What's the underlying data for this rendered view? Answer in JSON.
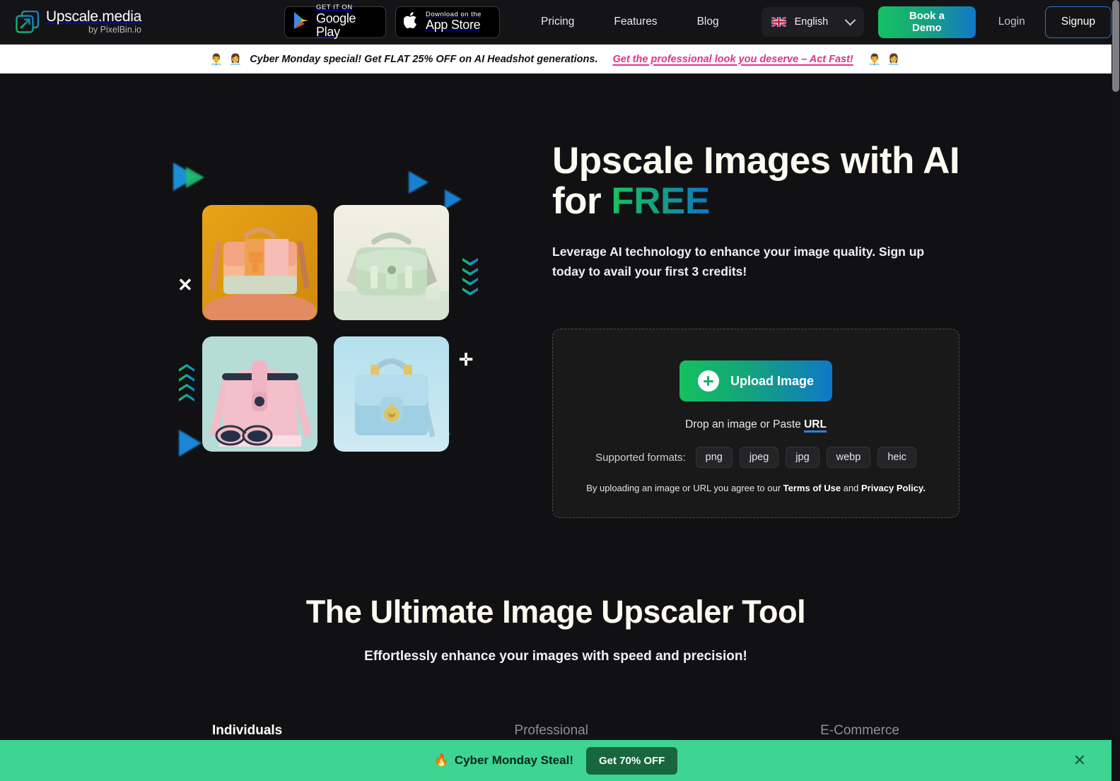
{
  "header": {
    "logo": {
      "title": "Upscale.media",
      "subtitle": "by PixelBin.io",
      "icon": "upscale-logo-icon"
    },
    "google_play": {
      "small": "GET IT ON",
      "big": "Google Play",
      "icon": "google-play-icon"
    },
    "app_store": {
      "small": "Download on the",
      "big": "App Store",
      "icon": "apple-icon"
    },
    "nav": [
      {
        "label": "Pricing"
      },
      {
        "label": "Features"
      },
      {
        "label": "Blog"
      }
    ],
    "language": {
      "label": "English",
      "flag": "uk-flag-icon",
      "chevron": "chevron-down-icon"
    },
    "book_demo": "Book a Demo",
    "login": "Login",
    "signup": "Signup"
  },
  "promo": {
    "emoji_left": "👨‍💼 👩‍💼",
    "text": "Cyber Monday special! Get FLAT 25% OFF on AI Headshot generations.",
    "cta": "Get the professional look you deserve – Act Fast!",
    "emoji_right": "👨‍💼 👩‍💼"
  },
  "hero": {
    "title_line1": "Upscale Images with AI",
    "title_line2_prefix": "for ",
    "title_highlight": "FREE",
    "subtitle": "Leverage AI technology to enhance your image quality. Sign up today to avail your first 3 credits!",
    "collage_alt": [
      "handbag-orange-tile",
      "handbag-mint-tile",
      "handbag-pink-tile",
      "handbag-blue-tile"
    ]
  },
  "upload": {
    "button_label": "Upload Image",
    "drop_text": "Drop an image or Paste ",
    "drop_link": "URL",
    "formats_label": "Supported formats:",
    "formats": [
      "png",
      "jpeg",
      "jpg",
      "webp",
      "heic"
    ],
    "legal_prefix": "By uploading an image or URL you agree to our ",
    "legal_terms": "Terms of Use",
    "legal_mid": " and ",
    "legal_privacy": "Privacy Policy."
  },
  "section2": {
    "heading": "The Ultimate Image Upscaler Tool",
    "subheading": "Effortlessly enhance your images with speed and precision!",
    "tabs": [
      {
        "label": "Individuals",
        "active": true
      },
      {
        "label": "Professional",
        "active": false
      },
      {
        "label": "E-Commerce",
        "active": false
      }
    ]
  },
  "sticky_bar": {
    "icon": "fire-icon",
    "text": "Cyber Monday Steal!",
    "button": "Get 70% OFF",
    "close": "✕"
  },
  "colors": {
    "accent_green": "#16c45f",
    "accent_blue": "#0f74c8",
    "promo_pink": "#e0318f",
    "sticky_green": "#3ed492",
    "sticky_button": "#18663e"
  }
}
